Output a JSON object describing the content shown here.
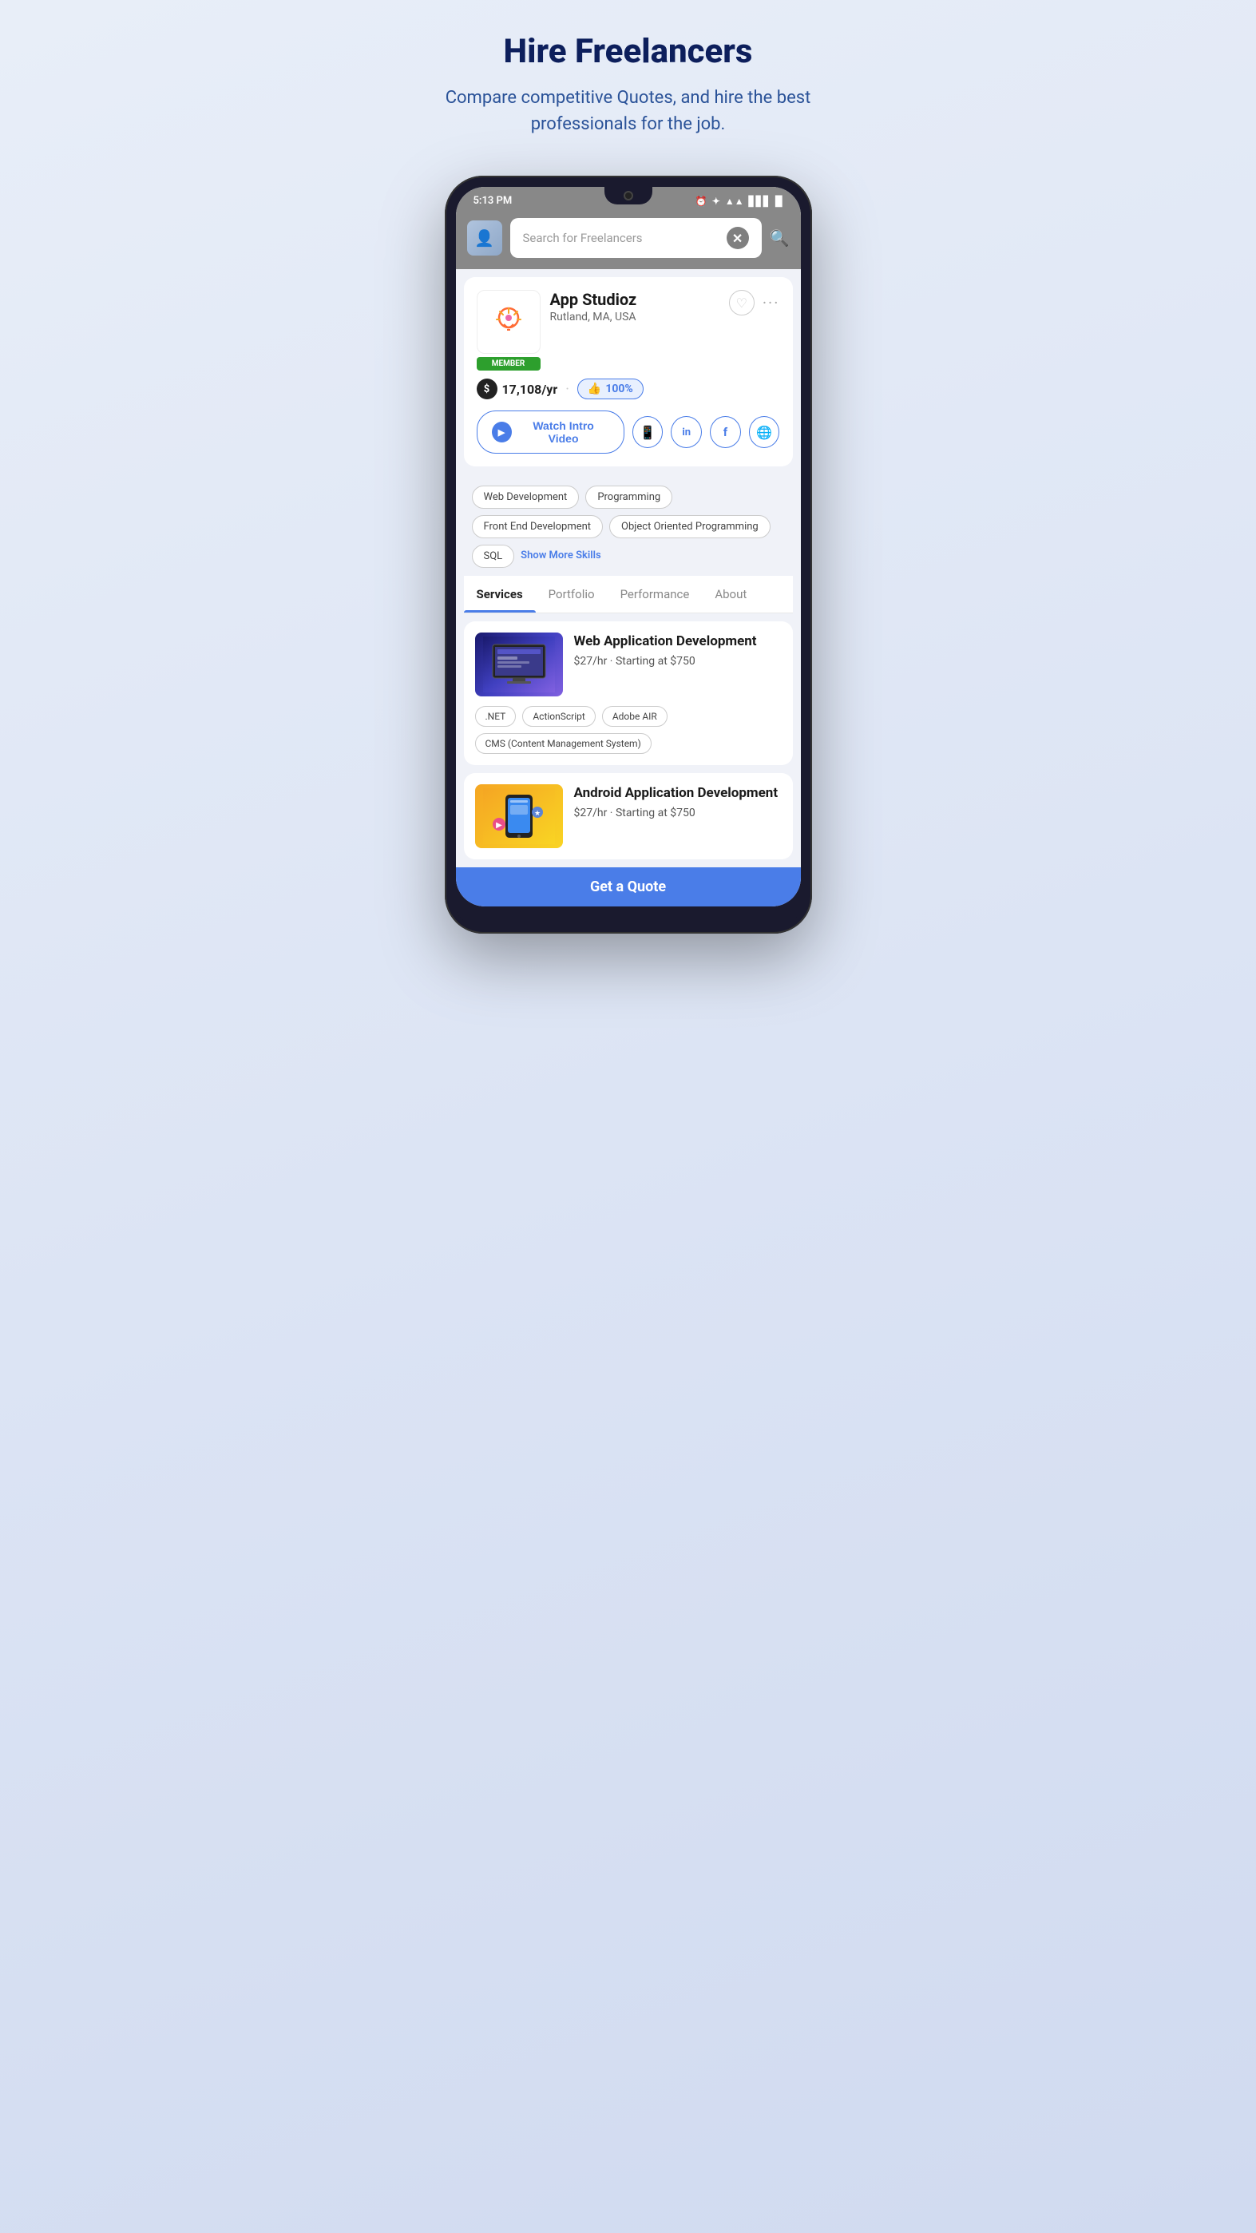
{
  "hero": {
    "title": "Hire Freelancers",
    "subtitle": "Compare competitive Quotes, and hire the best professionals for the job."
  },
  "phone": {
    "status_bar": {
      "time": "5:13 PM",
      "icons": [
        "⏰",
        "✦",
        "WiFi",
        "Signal",
        "Battery"
      ]
    },
    "search": {
      "placeholder": "Search for Freelancers"
    },
    "profile": {
      "name": "App Studioz",
      "location": "Rutland, MA, USA",
      "member_badge": "MEMBER",
      "rate": "17,108/yr",
      "rating": "100%",
      "logo_emoji": "💡"
    },
    "actions": {
      "watch_video": "Watch Intro Video",
      "social_whatsapp": "📱",
      "social_linkedin": "in",
      "social_facebook": "f",
      "social_globe": "🌐"
    },
    "skills": {
      "tags": [
        "Web Development",
        "Programming",
        "Front End Development",
        "Object Oriented Programming",
        "SQL"
      ],
      "show_more": "Show More Skills"
    },
    "tabs": [
      {
        "label": "Services",
        "active": true
      },
      {
        "label": "Portfolio",
        "active": false
      },
      {
        "label": "Performance",
        "active": false
      },
      {
        "label": "About",
        "active": false
      }
    ],
    "services": [
      {
        "title": "Web Application Development",
        "price": "$27/hr  ·  Starting at $750",
        "tags": [
          ".NET",
          "ActionScript",
          "Adobe AIR",
          "CMS (Content Management System)"
        ],
        "type": "web"
      },
      {
        "title": "Android Application Development",
        "price": "$27/hr  ·  Starting at $750",
        "tags": [],
        "type": "android"
      }
    ],
    "cta": "Get a Quote"
  }
}
